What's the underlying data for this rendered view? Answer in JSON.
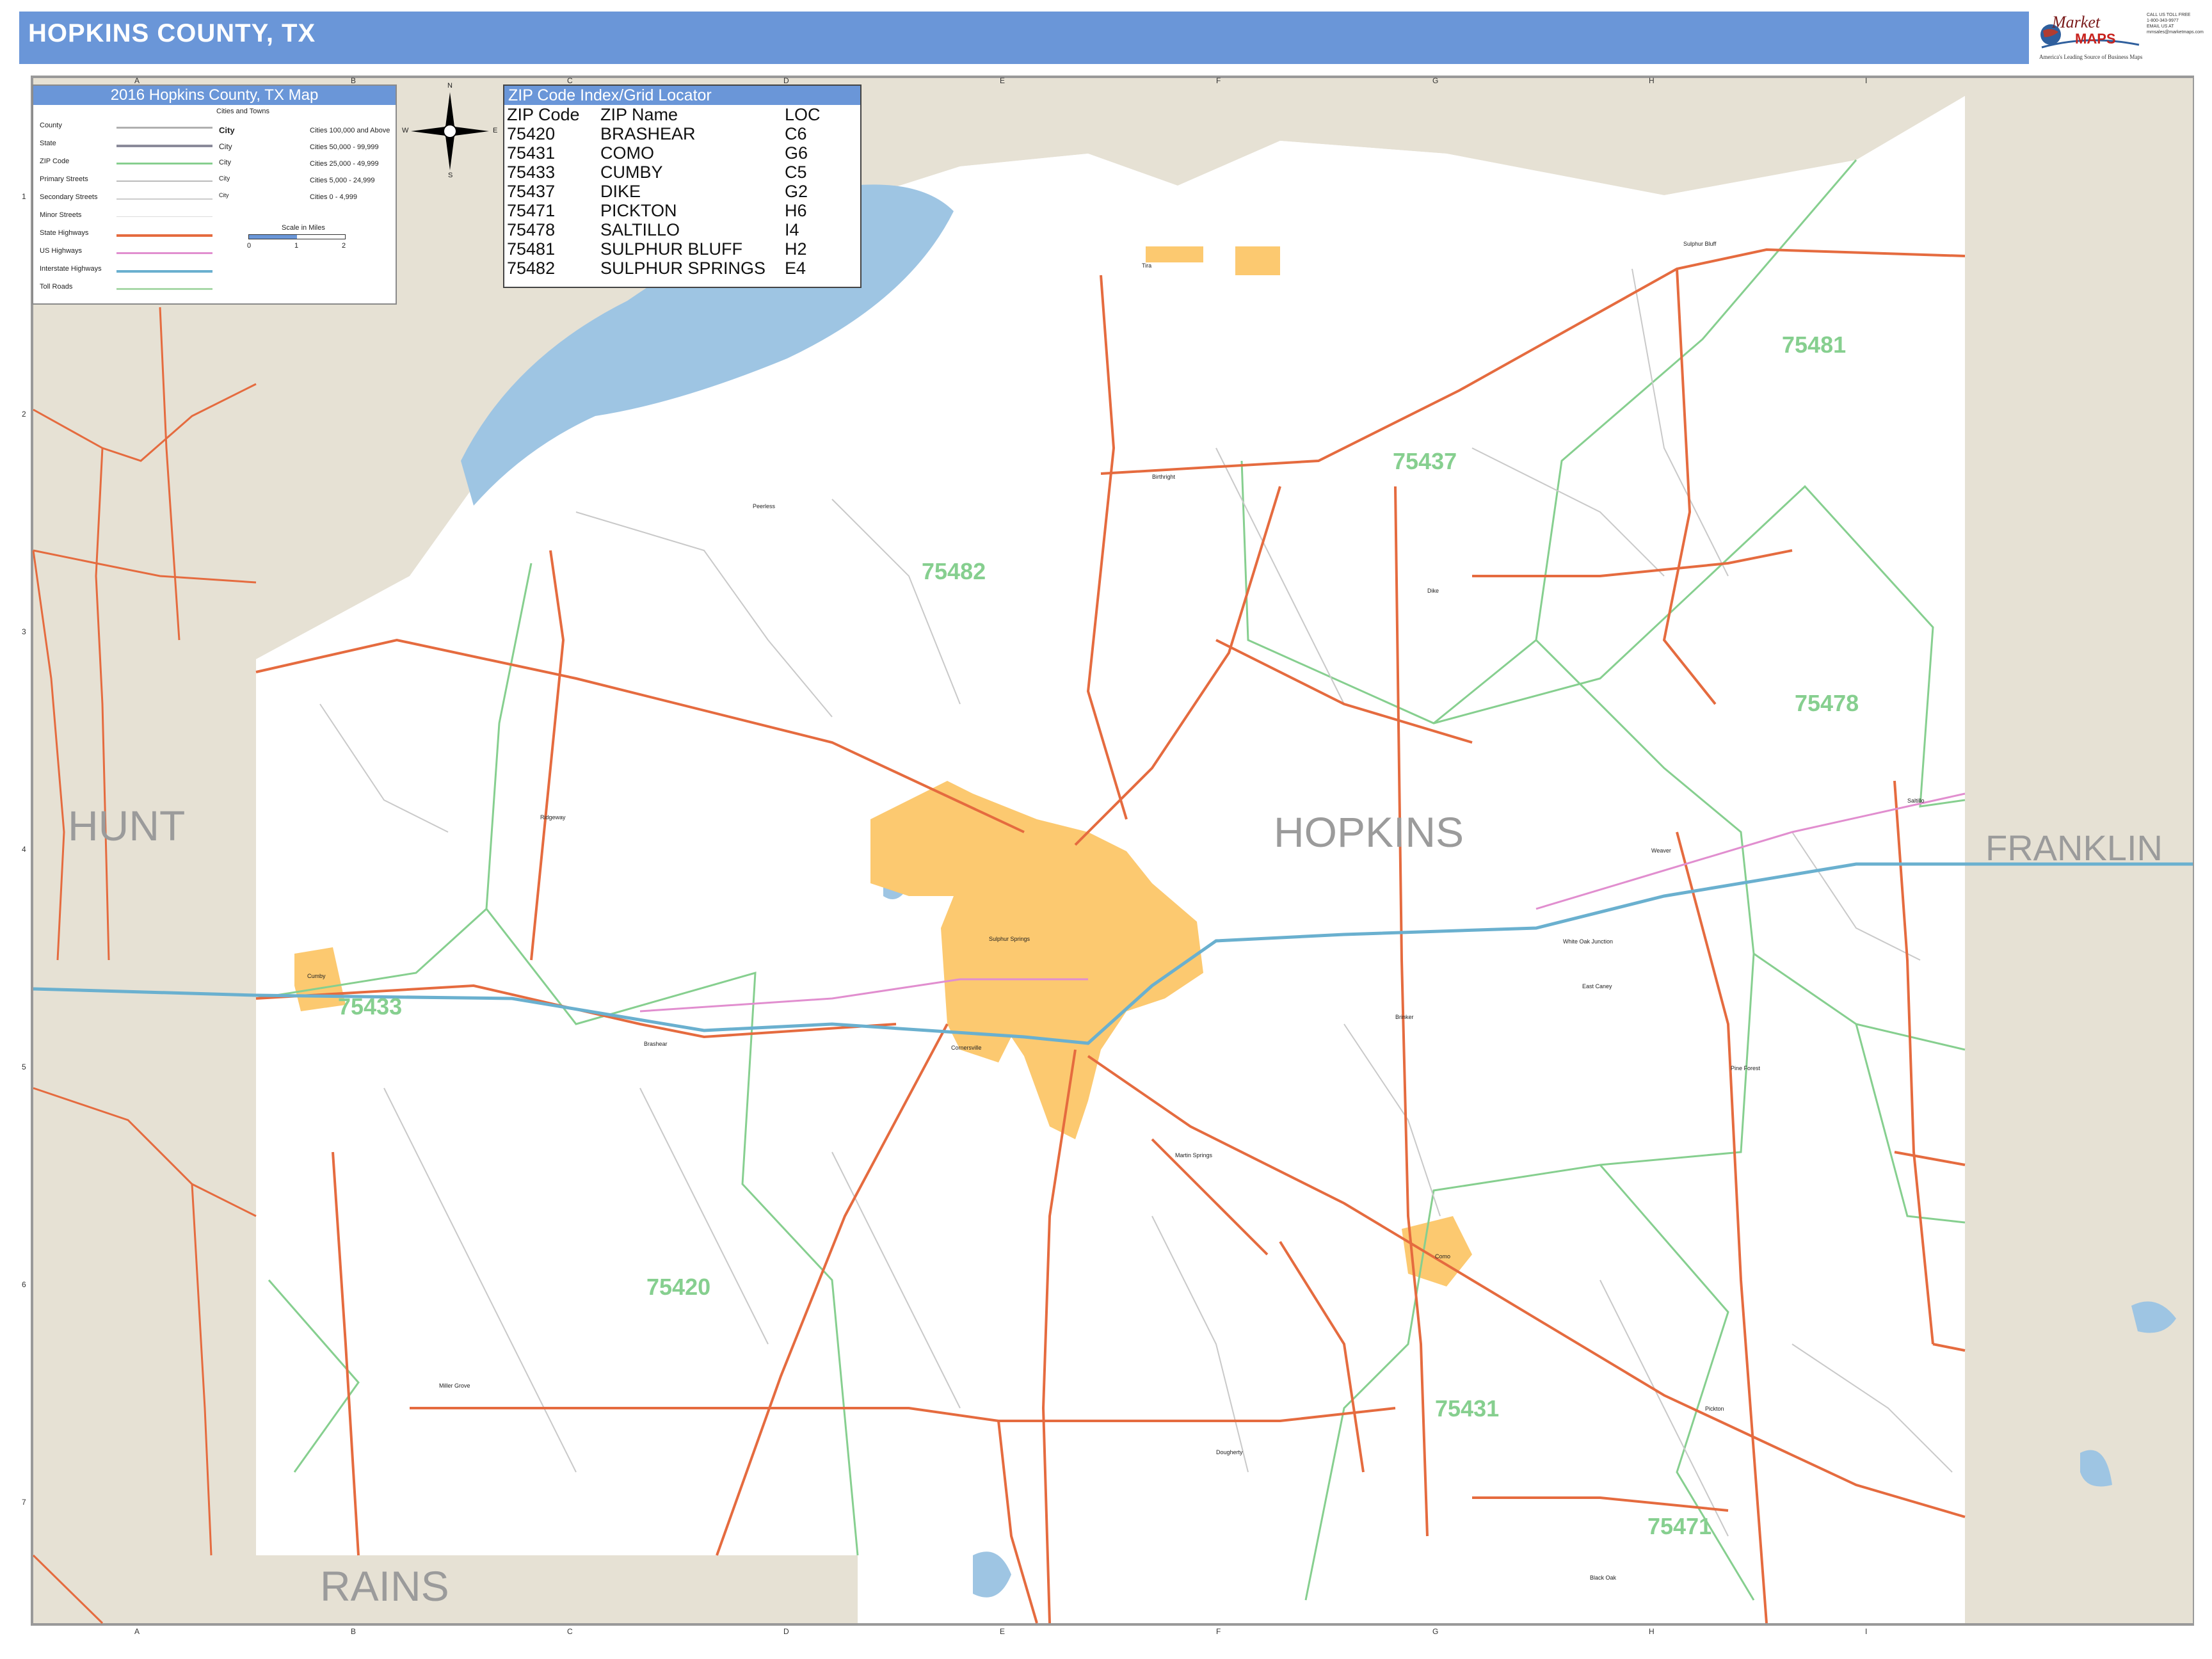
{
  "header": {
    "title": "HOPKINS COUNTY, TX"
  },
  "logo": {
    "brand_line1": "Market",
    "brand_line2": "MAPS",
    "tagline": "America's Leading Source of Business Maps",
    "contact": [
      "CALL US TOLL FREE",
      "1-800-343-9977",
      "EMAIL US AT",
      "mmsales@marketmaps.com"
    ]
  },
  "colors": {
    "header": "#6a96d8",
    "water": "#9ec5e3",
    "adjacent_county": "#e6e1d4",
    "city": "#fcc970",
    "state_highway": "#e56b3f",
    "zip_boundary": "#86cf8f",
    "interstate": "#6ab0cf",
    "us_highway": "#e18ecf"
  },
  "legend": {
    "title": "2016 Hopkins County, TX Map",
    "cities_heading": "Cities and Towns",
    "rows": [
      "County",
      "State",
      "ZIP Code",
      "Primary Streets",
      "Secondary Streets",
      "Minor Streets",
      "State Highways",
      "US Highways",
      "Interstate Highways",
      "Toll Roads"
    ],
    "city_samples": [
      "City",
      "City",
      "City",
      "City",
      "City"
    ],
    "city_classes": [
      "Cities 100,000 and Above",
      "Cities 50,000 - 99,999",
      "Cities 25,000 - 49,999",
      "Cities 5,000 - 24,999",
      "Cities 0 - 4,999"
    ],
    "scale_title": "Scale in Miles",
    "scale_ticks": [
      "0",
      "1",
      "2"
    ]
  },
  "compass": {
    "n": "N",
    "s": "S",
    "e": "E",
    "w": "W"
  },
  "zip_index": {
    "title": "ZIP Code Index/Grid Locator",
    "headers": [
      "ZIP Code",
      "ZIP Name",
      "LOC"
    ],
    "rows": [
      [
        "75420",
        "BRASHEAR",
        "C6"
      ],
      [
        "75431",
        "COMO",
        "G6"
      ],
      [
        "75433",
        "CUMBY",
        "C5"
      ],
      [
        "75437",
        "DIKE",
        "G2"
      ],
      [
        "75471",
        "PICKTON",
        "H6"
      ],
      [
        "75478",
        "SALTILLO",
        "I4"
      ],
      [
        "75481",
        "SULPHUR BLUFF",
        "H2"
      ],
      [
        "75482",
        "SULPHUR SPRINGS",
        "E4"
      ]
    ]
  },
  "grid": {
    "columns": [
      "A",
      "B",
      "C",
      "D",
      "E",
      "F",
      "G",
      "H",
      "I"
    ],
    "rows": [
      "1",
      "2",
      "3",
      "4",
      "5",
      "6",
      "7"
    ]
  },
  "counties": {
    "center": "HOPKINS",
    "west": "HUNT",
    "south": "RAINS",
    "east": "FRANKLIN"
  },
  "zip_labels": [
    "75481",
    "75437",
    "75482",
    "75478",
    "75433",
    "75420",
    "75431",
    "75471"
  ],
  "places": [
    "Sulphur Springs",
    "Sulphur Bluff",
    "Cumby",
    "Como",
    "Brashear",
    "Pickton",
    "Saltillo",
    "Dike",
    "Martin Springs",
    "Miller Grove",
    "Birthright",
    "Tira",
    "Weaver",
    "Brinker",
    "Black Oak",
    "Sulphur Bluff",
    "East Caney",
    "White Oak Junction",
    "Pine Forest",
    "Peerless",
    "Ridgeway",
    "Saltillo",
    "Cornersville",
    "Dougherty"
  ]
}
